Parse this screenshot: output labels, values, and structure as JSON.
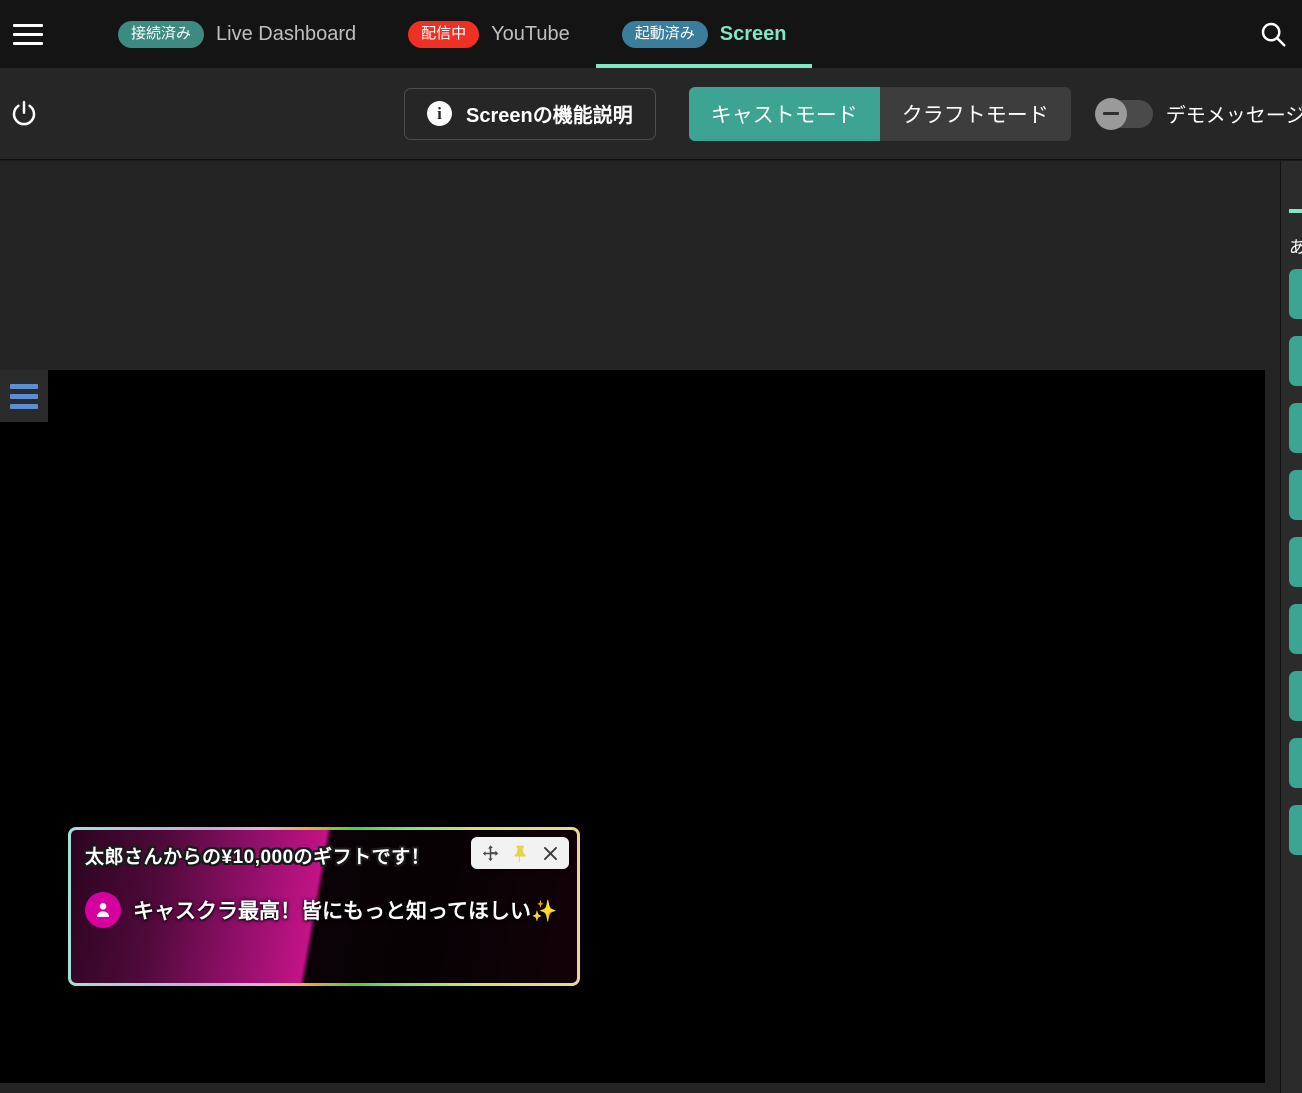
{
  "header": {
    "menu_icon": "hamburger-icon",
    "search_icon": "search-icon",
    "tabs": [
      {
        "badge": "接続済み",
        "label": "Live Dashboard",
        "badge_color": "#3d8b80",
        "active": false
      },
      {
        "badge": "配信中",
        "label": "YouTube",
        "badge_color": "#ef3124",
        "active": false
      },
      {
        "badge": "起動済み",
        "label": "Screen",
        "badge_color": "#3b7e9c",
        "active": true
      }
    ]
  },
  "toolbar": {
    "power_icon": "power-icon",
    "info_icon": "info-icon",
    "info_button_label": "Screenの機能説明",
    "modes": [
      {
        "label": "キャストモード",
        "selected": true
      },
      {
        "label": "クラフトモード",
        "selected": false
      }
    ],
    "demo_toggle": {
      "label": "デモメッセージを流す",
      "state": "off"
    }
  },
  "stage": {
    "menu_icon": "hamburger-icon",
    "background_color": "#000000"
  },
  "gift_card": {
    "title": "太郎さんからの¥10,000のギフトです！",
    "message": "キャスクラ最高！皆にもっと知ってほしい✨",
    "avatar_icon": "user-icon",
    "avatar_color": "#d6009e",
    "controls": [
      {
        "name": "move-icon",
        "glyph": "✥"
      },
      {
        "name": "pin-icon",
        "glyph": "📌"
      },
      {
        "name": "close-icon",
        "glyph": "✕"
      }
    ]
  },
  "right_panel": {
    "title": "あ",
    "accent_color": "#7fe7c4",
    "items": [
      {
        "label": ""
      },
      {
        "label": ""
      },
      {
        "label": ""
      },
      {
        "label": ""
      },
      {
        "label": ""
      },
      {
        "label": ""
      },
      {
        "label": ""
      },
      {
        "label": ""
      },
      {
        "label": ""
      }
    ]
  }
}
